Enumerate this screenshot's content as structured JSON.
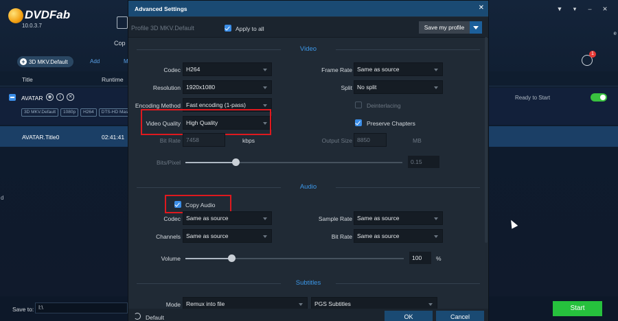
{
  "app": {
    "name": "DVDFab",
    "version": "10.0.3.7",
    "mode_label": "Cop",
    "right_edge_fragment": "e",
    "left_edge_fragment": "d",
    "profile_pill": "3D MKV.Default",
    "add_label": "Add",
    "m_label": "M",
    "notification_count": "1",
    "columns": {
      "title": "Title",
      "runtime": "Runtime"
    },
    "title_row": {
      "name": "AVATAR",
      "tags": [
        "3D MKV.Default",
        "1080p",
        "H264",
        "DTS-HD Mas"
      ],
      "status": "Ready to Start"
    },
    "selected_row": {
      "title": "AVATAR.Title0",
      "runtime": "02:41:41"
    },
    "save_to_label": "Save to:",
    "save_to_value": "I:\\",
    "start_label": "Start",
    "accent_color": "#26c13d"
  },
  "dialog": {
    "title": "Advanced Settings",
    "close_icon": "close-icon",
    "profile_name": "Profile 3D MKV.Default",
    "apply_to_all": "Apply to all",
    "save_profile": "Save my profile",
    "video": {
      "heading": "Video",
      "codec_label": "Codec",
      "codec_value": "H264",
      "resolution_label": "Resolution",
      "resolution_value": "1920x1080",
      "encoding_label": "Encoding Method",
      "encoding_value": "Fast encoding (1-pass)",
      "quality_label": "Video Quality",
      "quality_value": "High Quality",
      "framerate_label": "Frame Rate",
      "framerate_value": "Same as source",
      "split_label": "Split",
      "split_value": "No split",
      "deinterlacing_label": "Deinterlacing",
      "preserve_label": "Preserve Chapters",
      "bitrate_label": "Bit Rate",
      "bitrate_value": "7458",
      "bitrate_unit": "kbps",
      "outsize_label": "Output Size",
      "outsize_value": "8850",
      "outsize_unit": "MB",
      "bitspixel_label": "Bits/Pixel",
      "bitspixel_value": "0.15",
      "bitspixel_level": 0.23
    },
    "audio": {
      "heading": "Audio",
      "copy_label": "Copy Audio",
      "codec_label": "Codec",
      "codec_value": "Same as source",
      "channels_label": "Channels",
      "channels_value": "Same as source",
      "samplerate_label": "Sample Rate",
      "samplerate_value": "Same as source",
      "bitrate_label": "Bit Rate",
      "bitrate_value": "Same as source",
      "volume_label": "Volume",
      "volume_value": "100",
      "volume_unit": "%",
      "volume_level": 0.21
    },
    "subtitles": {
      "heading": "Subtitles",
      "mode_label": "Mode",
      "mode_value": "Remux into file",
      "format_value": "PGS Subtitles"
    },
    "footer": {
      "default_label": "Default",
      "ok_label": "OK",
      "cancel_label": "Cancel"
    },
    "highlight_color": "#e0191e"
  }
}
